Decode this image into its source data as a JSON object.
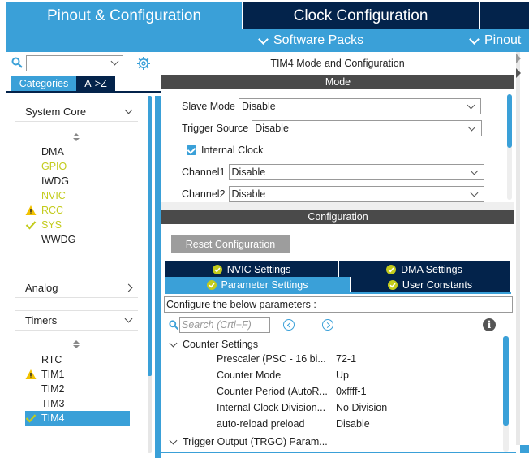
{
  "top_tabs": {
    "pinout": "Pinout & Configuration",
    "clock": "Clock Configuration"
  },
  "sub_menu": {
    "software_packs": "Software Packs",
    "pinout": "Pinout"
  },
  "left_panel": {
    "search_value": "",
    "category_tabs": [
      "Categories",
      "A->Z"
    ],
    "sections": {
      "system_core": "System Core",
      "analog": "Analog",
      "timers": "Timers"
    },
    "system_core_items": [
      {
        "label": "DMA",
        "state": "normal"
      },
      {
        "label": "GPIO",
        "state": "configured"
      },
      {
        "label": "IWDG",
        "state": "normal"
      },
      {
        "label": "NVIC",
        "state": "configured"
      },
      {
        "label": "RCC",
        "state": "warning"
      },
      {
        "label": "SYS",
        "state": "ok"
      },
      {
        "label": "WWDG",
        "state": "normal"
      }
    ],
    "timer_items": [
      {
        "label": "RTC",
        "state": "normal"
      },
      {
        "label": "TIM1",
        "state": "warning"
      },
      {
        "label": "TIM2",
        "state": "normal"
      },
      {
        "label": "TIM3",
        "state": "normal"
      },
      {
        "label": "TIM4",
        "state": "selected"
      }
    ]
  },
  "mode_panel": {
    "title": "TIM4 Mode and Configuration",
    "mode_header": "Mode",
    "slave_mode_label": "Slave Mode",
    "slave_mode_value": "Disable",
    "trigger_source_label": "Trigger Source",
    "trigger_source_value": "Disable",
    "internal_clock_label": "Internal Clock",
    "internal_clock_checked": true,
    "channel1_label": "Channel1",
    "channel1_value": "Disable",
    "channel2_label": "Channel2",
    "channel2_value": "Disable"
  },
  "config_panel": {
    "header": "Configuration",
    "reset_button": "Reset Configuration",
    "tabs": {
      "nvic": "NVIC Settings",
      "dma": "DMA Settings",
      "param": "Parameter Settings",
      "user": "User Constants"
    },
    "configure_text": "Configure the below parameters :",
    "search_placeholder": "Search (Crtl+F)",
    "counter_settings": "Counter Settings",
    "params": [
      {
        "name": "Prescaler (PSC - 16 bi...",
        "value": "72-1"
      },
      {
        "name": "Counter Mode",
        "value": "Up"
      },
      {
        "name": "Counter Period (AutoR...",
        "value": "0xffff-1"
      },
      {
        "name": "Internal Clock Division...",
        "value": "No Division"
      },
      {
        "name": "auto-reload preload",
        "value": "Disable"
      }
    ],
    "trigger_output": "Trigger Output (TRGO) Param..."
  },
  "colors": {
    "accent_blue": "#3aa0d8",
    "navy": "#03234b",
    "dark_bar": "#4a4a4a",
    "configured_green": "#c3cb1c",
    "warning_yellow": "#f2c200"
  }
}
